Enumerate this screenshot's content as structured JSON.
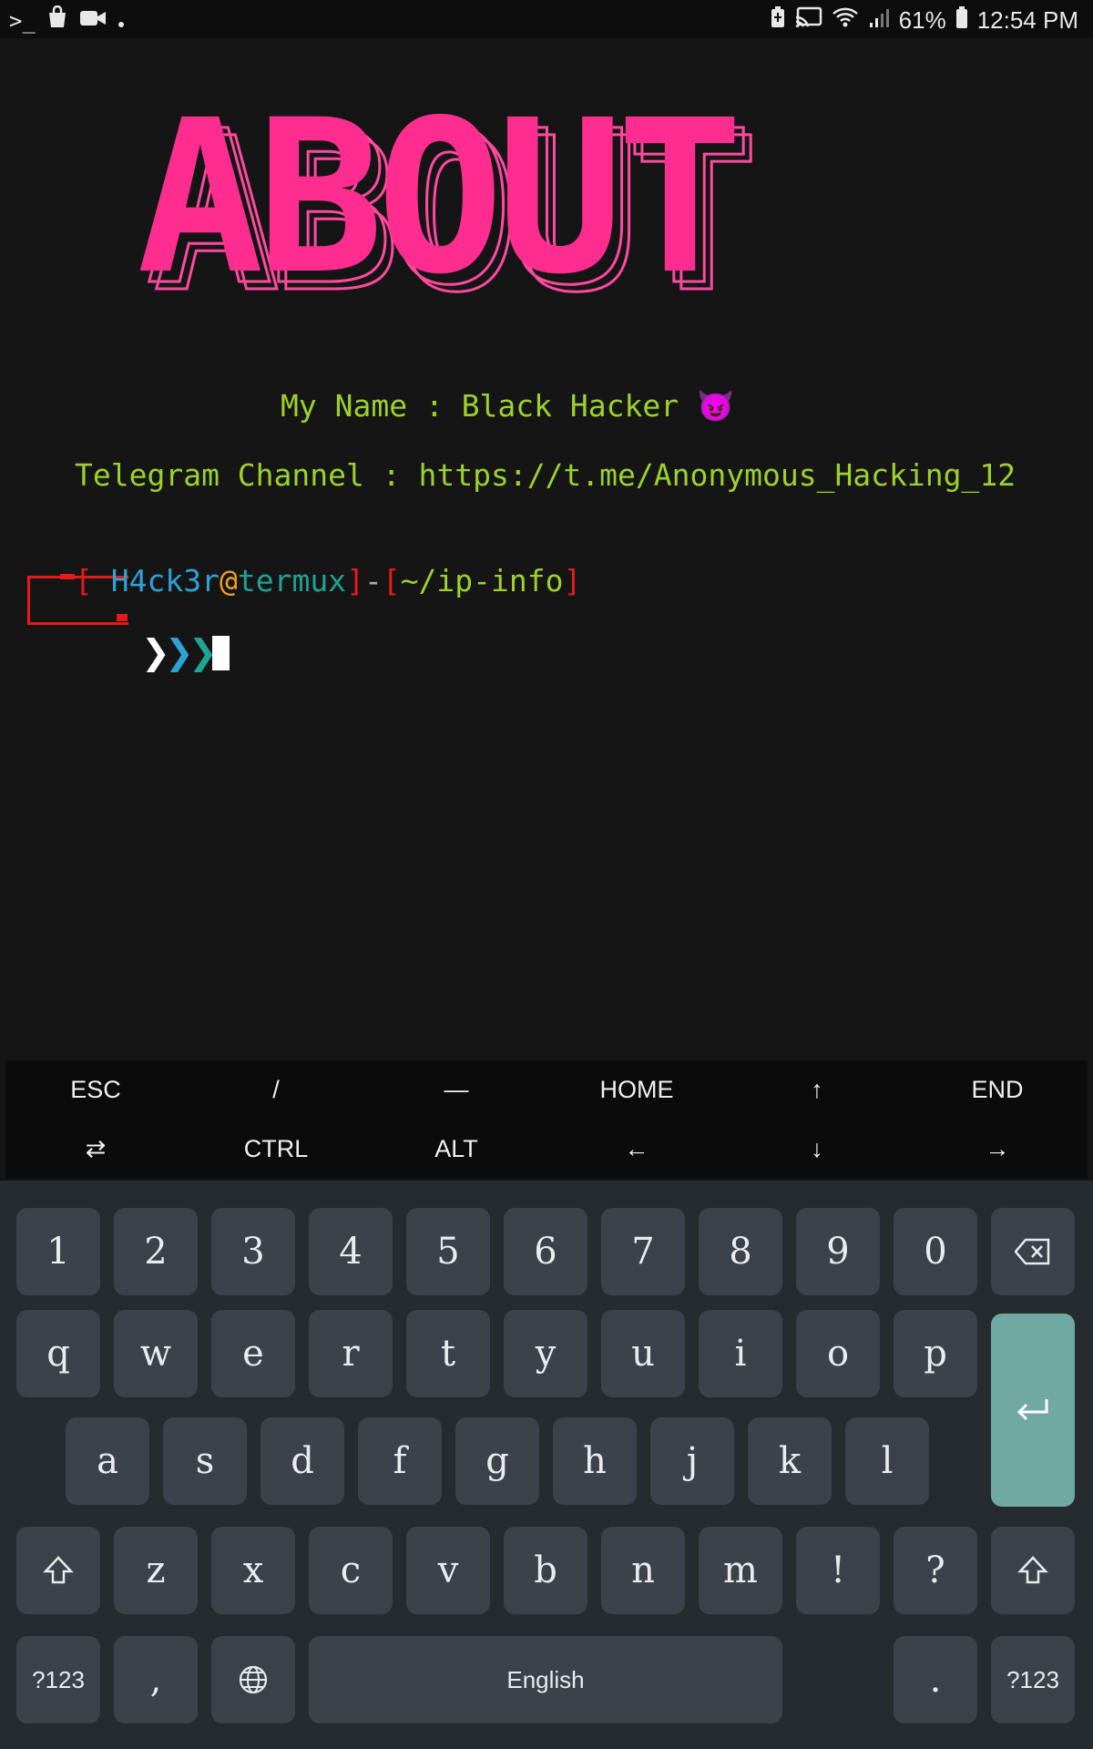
{
  "status_bar": {
    "left_icons": [
      "terminal-icon",
      "shopping-bag-icon",
      "video-camera-icon",
      "dot-icon"
    ],
    "right_icons": [
      "battery-saver-icon",
      "cast-icon",
      "wifi-icon",
      "signal-icon"
    ],
    "battery_percent": "61%",
    "time": "12:54 PM"
  },
  "terminal": {
    "banner_text": "ABOUT",
    "name_line": "My Name : Black Hacker 😈",
    "telegram_line": "Telegram Channel : https://t.me/Anonymous_Hacking_12",
    "prompt": {
      "open_bracket": "[",
      "user": "H4ck3r",
      "at": "@",
      "host": "termux",
      "close_bracket": "]",
      "dash": "-",
      "path_open": "[",
      "path": "~/ip-info",
      "path_close": "]",
      "chevrons": "❯❯❯"
    }
  },
  "extra_keys": {
    "row1": [
      "ESC",
      "/",
      "—",
      "HOME",
      "↑",
      "END"
    ],
    "row2": [
      "⇄",
      "CTRL",
      "ALT",
      "←",
      "↓",
      "→"
    ]
  },
  "keyboard": {
    "row_numbers": [
      "1",
      "2",
      "3",
      "4",
      "5",
      "6",
      "7",
      "8",
      "9",
      "0"
    ],
    "backspace_icon": "backspace-icon",
    "row_q": [
      "q",
      "w",
      "e",
      "r",
      "t",
      "y",
      "u",
      "i",
      "o",
      "p"
    ],
    "row_a": [
      "a",
      "s",
      "d",
      "f",
      "g",
      "h",
      "j",
      "k",
      "l"
    ],
    "row_z": [
      "z",
      "x",
      "c",
      "v",
      "b",
      "n",
      "m",
      "!",
      "?"
    ],
    "enter_icon": "enter-icon",
    "shift_icon": "shift-icon",
    "symbols_label": "?123",
    "comma_label": ",",
    "globe_icon": "globe-icon",
    "space_label": "English",
    "period_label": ".",
    "accent_color": "#6fa9a1"
  }
}
